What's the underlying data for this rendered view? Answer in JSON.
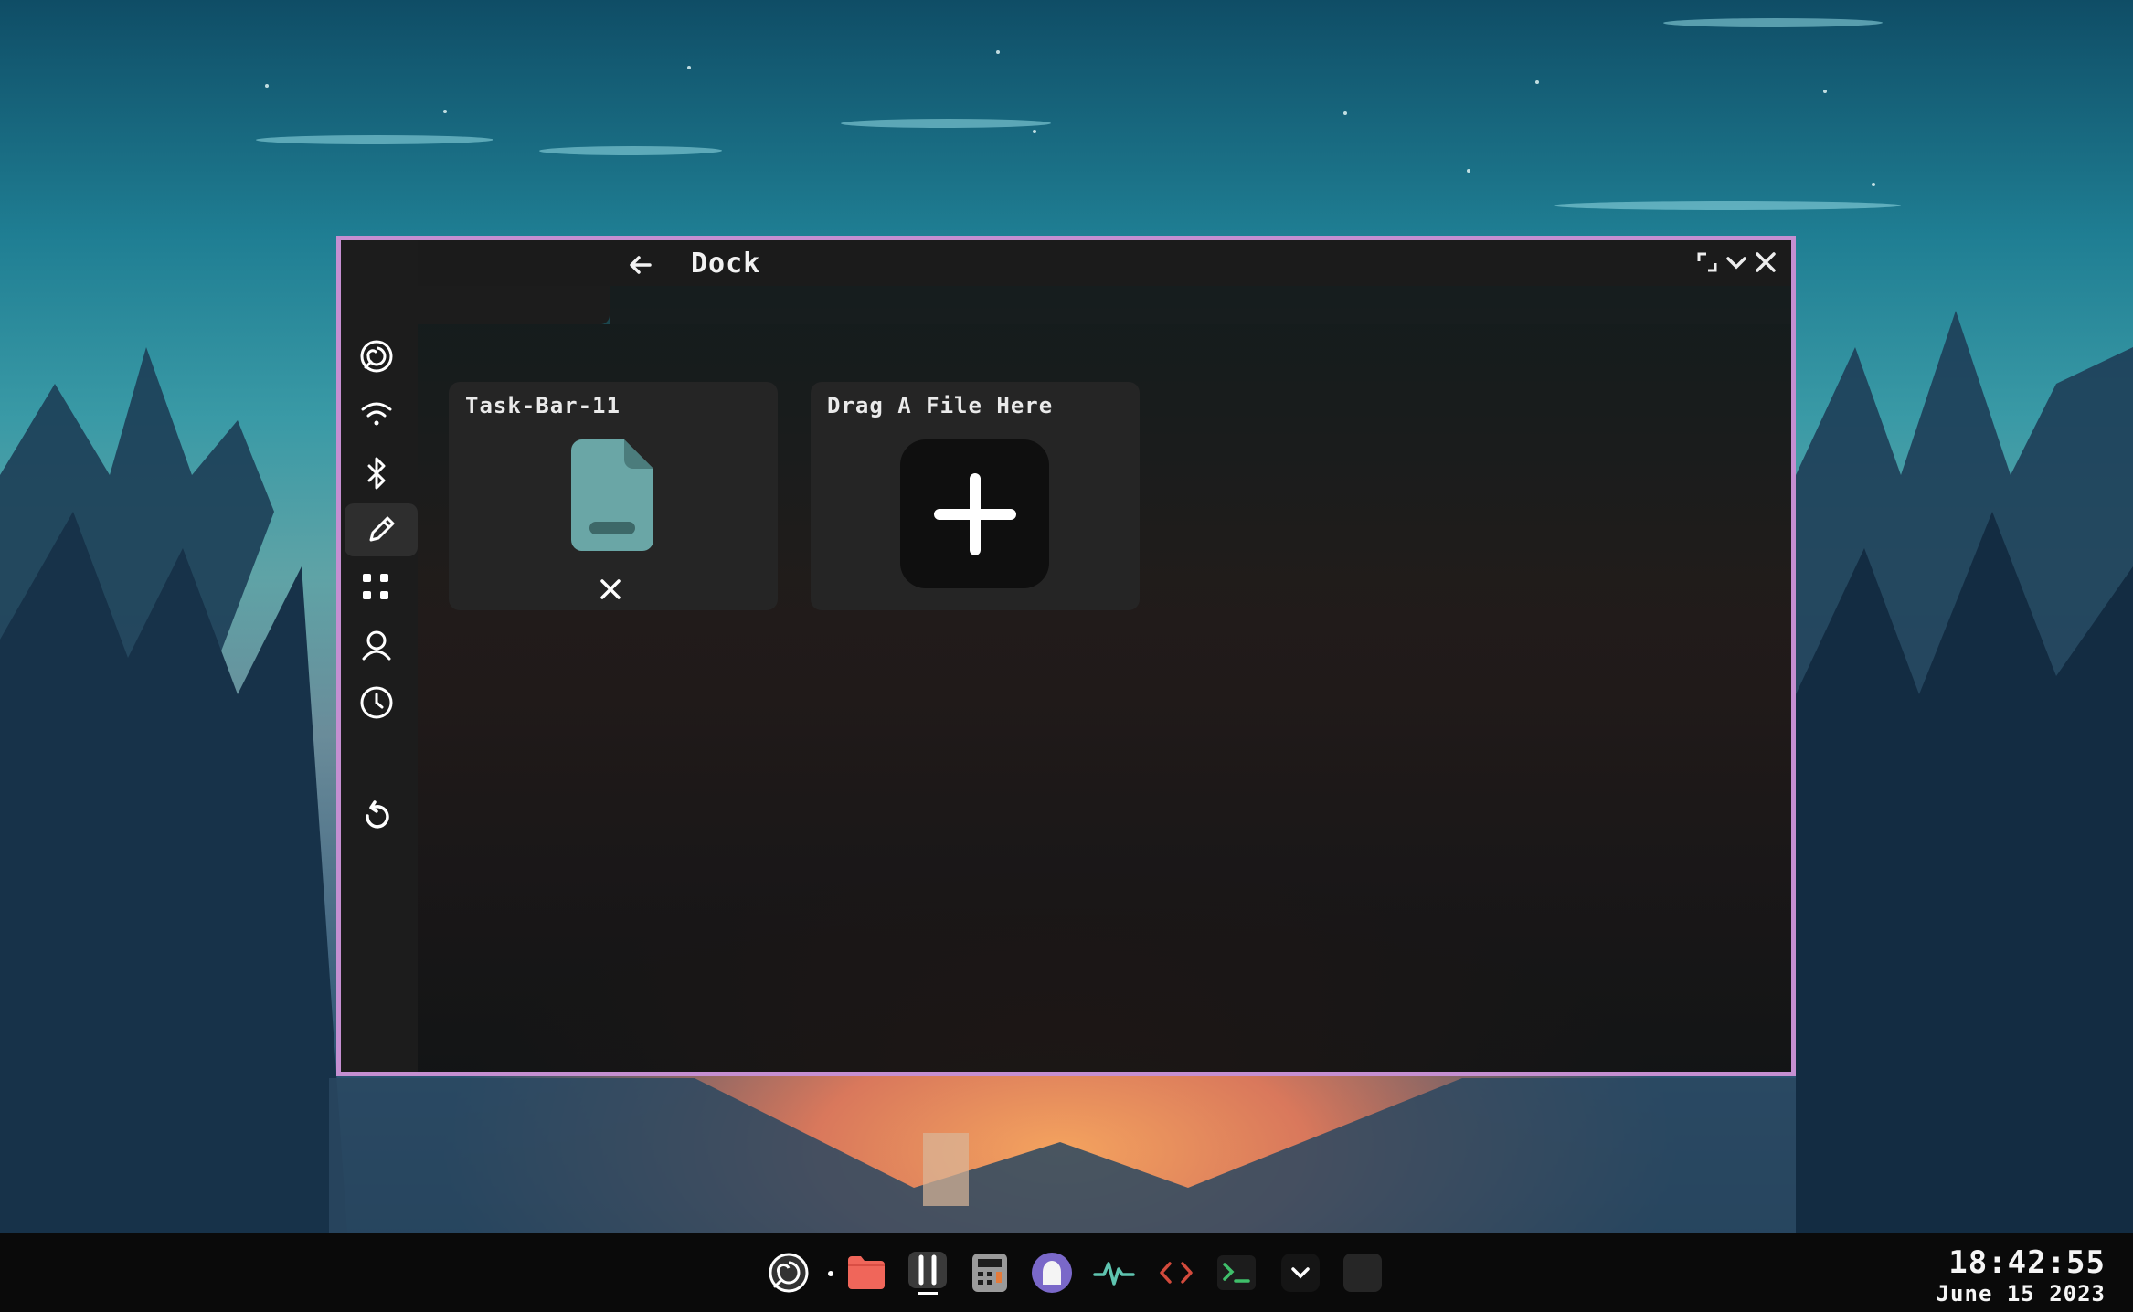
{
  "window": {
    "title": "Dock",
    "border_color": "#c58fd1",
    "back_icon": "arrow-left-icon",
    "controls": [
      "maximize-icon",
      "minimize-icon",
      "close-icon"
    ]
  },
  "sidebar": {
    "items": [
      {
        "icon": "swirl-logo-icon",
        "active": false
      },
      {
        "icon": "wifi-icon",
        "active": false
      },
      {
        "icon": "bluetooth-icon",
        "active": false
      },
      {
        "icon": "pencil-icon",
        "active": true
      },
      {
        "icon": "apps-grid-icon",
        "active": false
      },
      {
        "icon": "user-icon",
        "active": false
      },
      {
        "icon": "clock-icon",
        "active": false
      },
      {
        "icon": "reset-icon",
        "active": false
      }
    ]
  },
  "cards": [
    {
      "title": "Task-Bar-11",
      "icon": "file-icon",
      "icon_color": "#6aa6a6",
      "action_icon": "close-icon"
    },
    {
      "title": "Drag A File Here",
      "icon": "plus-icon"
    }
  ],
  "taskbar": {
    "apps": [
      "swirl-logo-icon",
      "folder-icon",
      "settings-sliders-icon",
      "calculator-icon",
      "ghost-icon",
      "activity-monitor-icon",
      "code-editor-icon",
      "terminal-icon",
      "chevron-down-icon",
      "blank-app-icon"
    ],
    "clock": {
      "time": "18:42:55",
      "date": "June 15 2023"
    }
  }
}
